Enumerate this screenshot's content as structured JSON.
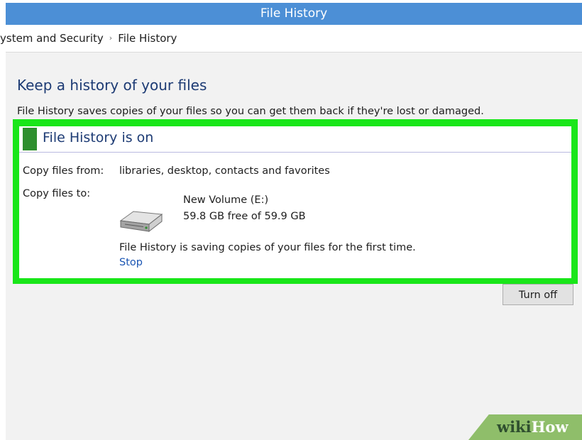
{
  "window": {
    "title": "File History"
  },
  "breadcrumb": {
    "items": [
      "ystem and Security",
      "File History"
    ],
    "separator": "›"
  },
  "main": {
    "heading": "Keep a history of your files",
    "description": "File History saves copies of your files so you can get them back if they're lost or damaged.",
    "status_title": "File History is on",
    "copy_from_label": "Copy files from:",
    "copy_from_value": "libraries, desktop, contacts and favorites",
    "copy_to_label": "Copy files to:",
    "drive": {
      "name": "New Volume (E:)",
      "space": "59.8 GB free of 59.9 GB",
      "icon": "hard-drive-icon"
    },
    "progress_message": "File History is saving copies of your files for the first time.",
    "stop_link": "Stop",
    "turn_off_button": "Turn off"
  },
  "watermark": {
    "part1": "wiki",
    "part2": "How"
  },
  "colors": {
    "titlebar": "#4c8fd6",
    "highlight": "#19e619",
    "status_indicator": "#2f8f2f",
    "heading_text": "#1d3b74",
    "link": "#1a55b3"
  }
}
